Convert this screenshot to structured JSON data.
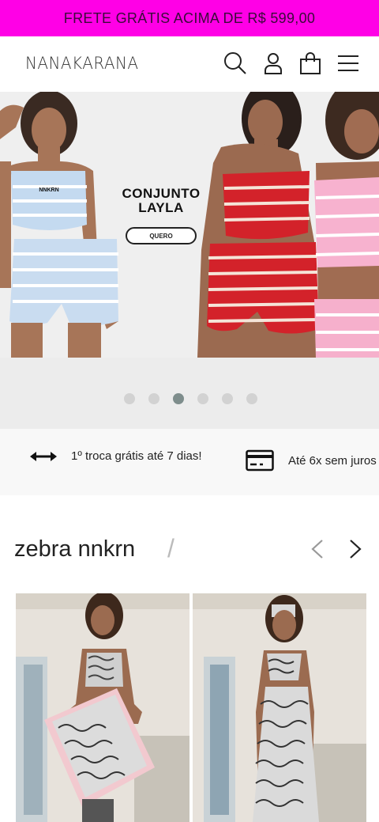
{
  "promo": {
    "text": "FRETE GRÁTIS ACIMA DE R$ 599,00"
  },
  "header": {
    "logo": "NANAKARANA",
    "icons": [
      "search-icon",
      "user-icon",
      "bag-icon",
      "menu-icon"
    ]
  },
  "hero": {
    "title_line1": "CONJUNTO",
    "title_line2": "LAYLA",
    "button": "QUERO",
    "shirt_text": "NNKRN",
    "slides": 6,
    "active_slide": 3
  },
  "benefits": [
    {
      "icon": "double-arrow-icon",
      "text": "1º troca grátis até 7 dias!"
    },
    {
      "icon": "credit-card-icon",
      "text": "Até 6x sem juros"
    }
  ],
  "section": {
    "title": "zebra nnkrn",
    "slash": "/"
  },
  "colors": {
    "promo_bg": "#ff00e6",
    "active_dot": "#7e8d8c",
    "inactive_dot": "#d2d2d2"
  }
}
